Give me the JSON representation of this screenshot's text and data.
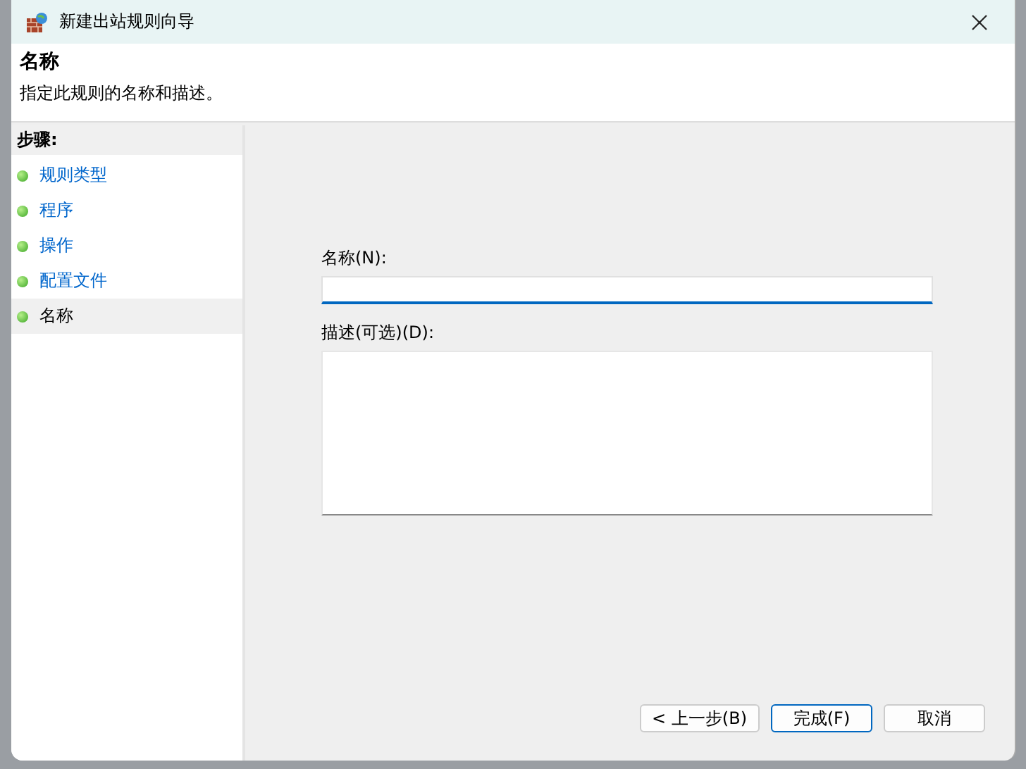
{
  "window": {
    "title": "新建出站规则向导"
  },
  "header": {
    "title": "名称",
    "subtitle": "指定此规则的名称和描述。"
  },
  "steps": {
    "heading": "步骤:",
    "items": [
      {
        "label": "规则类型",
        "selected": false
      },
      {
        "label": "程序",
        "selected": false
      },
      {
        "label": "操作",
        "selected": false
      },
      {
        "label": "配置文件",
        "selected": false
      },
      {
        "label": "名称",
        "selected": true
      }
    ]
  },
  "form": {
    "name_label": "名称(N):",
    "description_label": "描述(可选)(D):"
  },
  "buttons": [
    {
      "label": "< 上一步(B)",
      "default": false
    },
    {
      "label": "完成(F)",
      "default": true
    },
    {
      "label": "取消",
      "default": false
    }
  ]
}
